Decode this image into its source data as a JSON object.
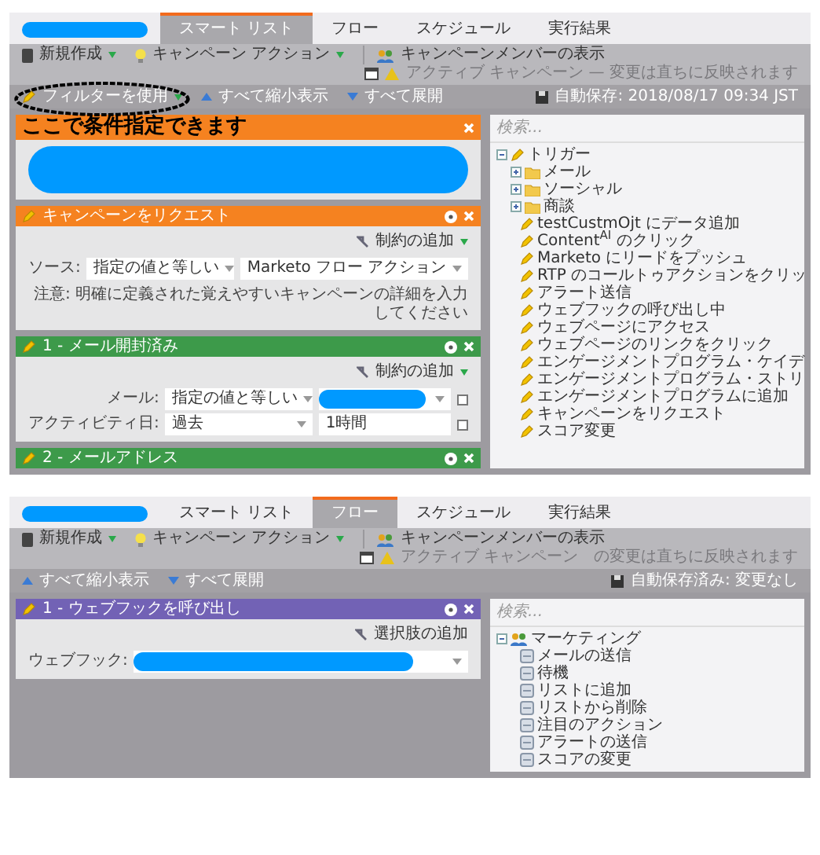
{
  "screens": [
    {
      "tabs": [
        {
          "label": "スマート リスト",
          "selected": true
        },
        {
          "label": "フロー",
          "selected": false
        },
        {
          "label": "スケジュール",
          "selected": false
        },
        {
          "label": "実行結果",
          "selected": false
        }
      ],
      "toolbar": {
        "new": "新規作成",
        "actions": "キャンペーン アクション",
        "members": "キャンペーンメンバーの表示",
        "notice": "アクティブ キャンペーン — 変更は直ちに反映されます"
      },
      "subtoolbar": {
        "filter": "フィルターを使用",
        "collapse": "すべて縮小表示",
        "expand": "すべて展開",
        "autosave": "自動保存: 2018/08/17 09:34 JST"
      },
      "blocks": [
        {
          "kind": "campaign",
          "annotation": "ここで条件指定できます",
          "redacted": true
        },
        {
          "kind": "campaign",
          "title": "キャンペーンをリクエスト",
          "link": "制約の追加",
          "rows": [
            {
              "label": "ソース:",
              "fields": [
                {
                  "kind": "select",
                  "value": "指定の値と等しい"
                },
                {
                  "kind": "select",
                  "value": "Marketo フロー アクション"
                }
              ]
            }
          ],
          "note": "注意: 明確に定義された覚えやすいキャンペーンの詳細を入力してください"
        },
        {
          "kind": "trigger",
          "title": "1 - メール開封済み",
          "link": "制約の追加",
          "rows": [
            {
              "label": "メール:",
              "fields": [
                {
                  "kind": "select",
                  "value": "指定の値と等しい"
                },
                {
                  "kind": "redacted"
                }
              ]
            },
            {
              "label": "アクティビティ日:",
              "fields": [
                {
                  "kind": "select",
                  "value": "過去"
                },
                {
                  "kind": "text",
                  "value": "1時間"
                }
              ]
            }
          ]
        },
        {
          "kind": "trigger",
          "title": "2 - メールアドレス"
        }
      ],
      "search": {
        "placeholder": "検索..."
      },
      "tree": [
        {
          "label": "トリガー",
          "kind": "trigger-group",
          "expanded": true,
          "children": [
            {
              "label": "メール",
              "kind": "folder",
              "expanded": false
            },
            {
              "label": "ソーシャル",
              "kind": "folder",
              "expanded": false
            },
            {
              "label": "商談",
              "kind": "folder",
              "expanded": false
            },
            {
              "label": "testCustmOjt にデータ追加",
              "kind": "trigger"
            },
            {
              "label": "Content$^{AI}$ のクリック",
              "kind": "trigger"
            },
            {
              "label": "Marketo にリードをプッシュ",
              "kind": "trigger"
            },
            {
              "label": "RTP のコールトゥアクションをクリッ",
              "kind": "trigger"
            },
            {
              "label": "アラート送信",
              "kind": "trigger"
            },
            {
              "label": "ウェブフックの呼び出し中",
              "kind": "trigger"
            },
            {
              "label": "ウェブページにアクセス",
              "kind": "trigger"
            },
            {
              "label": "ウェブページのリンクをクリック",
              "kind": "trigger"
            },
            {
              "label": "エンゲージメントプログラム・ケイデ",
              "kind": "trigger"
            },
            {
              "label": "エンゲージメントプログラム・ストリ",
              "kind": "trigger"
            },
            {
              "label": "エンゲージメントプログラムに追加",
              "kind": "trigger"
            },
            {
              "label": "キャンペーンをリクエスト",
              "kind": "trigger"
            },
            {
              "label": "スコア変更",
              "kind": "trigger"
            }
          ]
        }
      ]
    },
    {
      "tabs": [
        {
          "label": "スマート リスト",
          "selected": false
        },
        {
          "label": "フロー",
          "selected": true
        },
        {
          "label": "スケジュール",
          "selected": false
        },
        {
          "label": "実行結果",
          "selected": false
        }
      ],
      "toolbar": {
        "new": "新規作成",
        "actions": "キャンペーン アクション",
        "members": "キャンペーンメンバーの表示",
        "notice": "アクティブ キャンペーン　の変更は直ちに反映されます"
      },
      "subtoolbar": {
        "collapse": "すべて縮小表示",
        "expand": "すべて展開",
        "autosave": "自動保存済み: 変更なし"
      },
      "blocks": [
        {
          "kind": "flow",
          "title": "1 - ウェブフックを呼び出し",
          "link": "選択肢の追加",
          "rows": [
            {
              "label": "ウェブフック:",
              "fields": [
                {
                  "kind": "redacted"
                }
              ]
            }
          ]
        }
      ],
      "search": {
        "placeholder": "検索..."
      },
      "tree": [
        {
          "label": "マーケティング",
          "kind": "flow-group",
          "expanded": true,
          "children": [
            {
              "label": "メールの送信",
              "kind": "flow"
            },
            {
              "label": "待機",
              "kind": "flow"
            },
            {
              "label": "リストに追加",
              "kind": "flow"
            },
            {
              "label": "リストから削除",
              "kind": "flow"
            },
            {
              "label": "注目のアクション",
              "kind": "flow"
            },
            {
              "label": "アラートの送信",
              "kind": "flow"
            },
            {
              "label": "スコアの変更",
              "kind": "flow"
            }
          ]
        }
      ]
    }
  ]
}
